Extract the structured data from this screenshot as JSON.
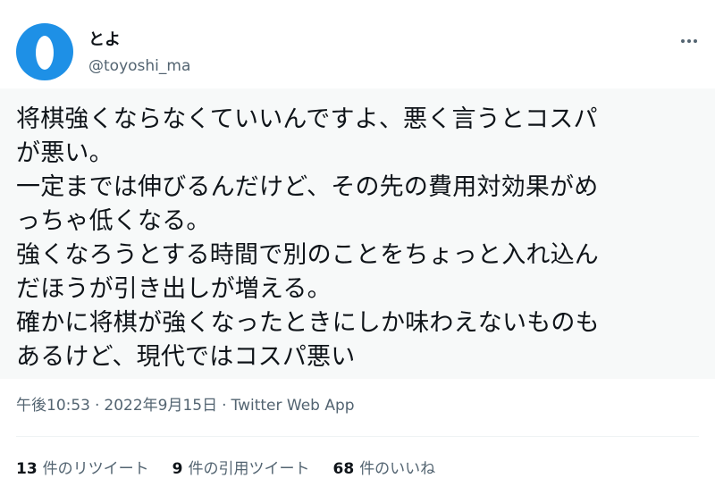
{
  "author": {
    "display_name": "とよ",
    "handle": "@toyoshi_ma",
    "avatar_color": "#1e90e6"
  },
  "tweet": {
    "text": "将棋強くならなくていいんですよ、悪く言うとコスパ\nが悪い。\n一定までは伸びるんだけど、その先の費用対効果がめ\nっちゃ低くなる。\n強くなろうとする時間で別のことをちょっと入れ込ん\nだほうが引き出しが増える。\n確かに将棋が強くなったときにしか味わえないものも\nあるけど、現代ではコスパ悪い",
    "time": "午後10:53",
    "date": "2022年9月15日",
    "source": "Twitter Web App",
    "separator": "·"
  },
  "stats": {
    "retweets_count": "13",
    "retweets_label": "件のリツイート",
    "quotes_count": "9",
    "quotes_label": "件の引用ツイート",
    "likes_count": "68",
    "likes_label": "件のいいね"
  },
  "icons": {
    "more": "more-horizontal-icon"
  },
  "colors": {
    "text": "#0f1419",
    "secondary": "#536471",
    "highlight_bg": "#f7f9f9"
  }
}
